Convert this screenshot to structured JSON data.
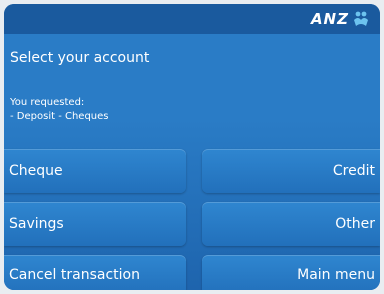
{
  "brand": {
    "logo_text": "ANZ"
  },
  "screen": {
    "title": "Select your account",
    "requested_label": "You requested:",
    "requested_value": "- Deposit - Cheques"
  },
  "buttons": {
    "cheque": "Cheque",
    "credit": "Credit",
    "savings": "Savings",
    "other": "Other",
    "cancel": "Cancel transaction",
    "main_menu": "Main menu"
  },
  "colors": {
    "background": "#2a7cc6",
    "topbar": "#1a5a9e",
    "button": "#2774bf",
    "logo_accent": "#6cc3ef"
  }
}
